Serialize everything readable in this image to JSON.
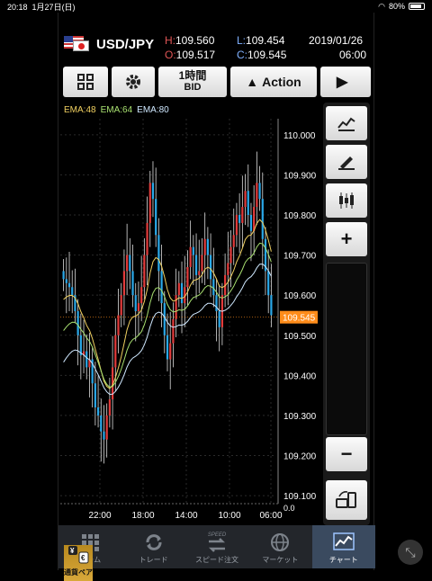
{
  "status": {
    "time": "20:18",
    "date": "1月27日(日)",
    "battery": "80%"
  },
  "quote": {
    "pair": "USD/JPY",
    "high_label": "H:",
    "high": "109.560",
    "open_label": "O:",
    "open": "109.517",
    "low_label": "L:",
    "low": "109.454",
    "close_label": "C:",
    "close": "109.545",
    "date": "2019/01/26",
    "time": "06:00"
  },
  "toolbar": {
    "timeframe": "1時間",
    "price_type": "BID",
    "action": "Action"
  },
  "chart": {
    "legend": [
      {
        "label": "EMA:48",
        "color": "#f0d060"
      },
      {
        "label": "EMA:64",
        "color": "#a8e070"
      },
      {
        "label": "EMA:80",
        "color": "#cfe8ff"
      }
    ],
    "current_price": "109.545",
    "current_price_color": "#ff8c1a",
    "y_labels": [
      "110.000",
      "109.900",
      "109.800",
      "109.700",
      "109.600",
      "109.500",
      "109.400",
      "109.300",
      "109.200",
      "109.100"
    ],
    "x_labels": [
      "22:00",
      "18:00",
      "14:00",
      "10:00",
      "06:00"
    ],
    "zero_label": "0.0"
  },
  "chart_data": {
    "type": "candlestick",
    "ylim": [
      109.08,
      110.04
    ],
    "current_price": 109.545,
    "x_ticks": [
      "22:00",
      "18:00",
      "14:00",
      "10:00",
      "06:00"
    ],
    "series": [
      {
        "name": "EMA:48",
        "color": "#f0d060"
      },
      {
        "name": "EMA:64",
        "color": "#a8e070"
      },
      {
        "name": "EMA:80",
        "color": "#cfe8ff"
      }
    ]
  },
  "side": {
    "zoom_in": "+",
    "zoom_out": "−"
  },
  "nav": [
    {
      "label": "ホーム",
      "icon": "home-grid-icon"
    },
    {
      "label": "トレード",
      "icon": "refresh-icon"
    },
    {
      "label": "スピード注文",
      "icon": "speed-order-icon"
    },
    {
      "label": "マーケット",
      "icon": "globe-icon"
    },
    {
      "label": "チャート",
      "icon": "chart-icon"
    },
    {
      "label": "通貨ペア",
      "icon": "currency-pair-icon"
    }
  ],
  "nav_badge": "SPEED"
}
